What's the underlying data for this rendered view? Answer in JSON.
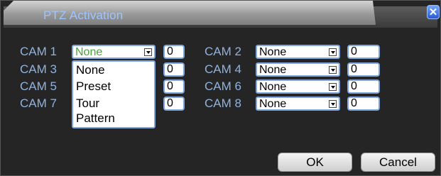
{
  "title": "PTZ Activation",
  "close_label": "✕",
  "cams": [
    {
      "label": "CAM 1",
      "value": "None",
      "num": "0"
    },
    {
      "label": "CAM 2",
      "value": "None",
      "num": "0"
    },
    {
      "label": "CAM 3",
      "value": "",
      "num": "0"
    },
    {
      "label": "CAM 4",
      "value": "None",
      "num": "0"
    },
    {
      "label": "CAM 5",
      "value": "",
      "num": "0"
    },
    {
      "label": "CAM 6",
      "value": "None",
      "num": "0"
    },
    {
      "label": "CAM 7",
      "value": "",
      "num": "0"
    },
    {
      "label": "CAM 8",
      "value": "None",
      "num": "0"
    }
  ],
  "dropdown_options": [
    "None",
    "Preset",
    "Tour",
    "Pattern"
  ],
  "buttons": {
    "ok": "OK",
    "cancel": "Cancel"
  },
  "colors": {
    "label": "#8fb3de",
    "title": "#9dc5ff",
    "active_value": "#4aa23a",
    "accent": "#7fa7de"
  },
  "icons": {
    "close": "close-icon",
    "dropdown_arrow": "chevron-down-icon"
  }
}
